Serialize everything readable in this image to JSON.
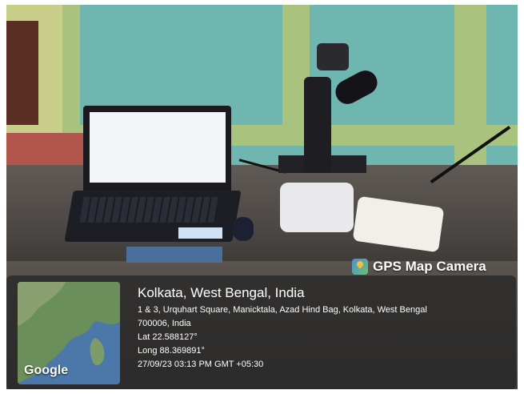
{
  "watermark": {
    "label": "GPS Map Camera",
    "icon": "gps-map-camera-icon"
  },
  "location": {
    "title": "Kolkata, West Bengal, India",
    "address_line1": "1 & 3, Urquhart Square, Manicktala, Azad Hind Bag, Kolkata, West Bengal",
    "address_line2": "700006, India",
    "latitude": "Lat 22.588127°",
    "longitude": "Long 88.369891°",
    "timestamp": "27/09/23 03:13 PM GMT +05:30"
  },
  "map": {
    "attribution": "Google"
  },
  "colors": {
    "panel_background": "#282828",
    "map_water": "#4b78a8",
    "map_land": "#6b8f5a"
  }
}
